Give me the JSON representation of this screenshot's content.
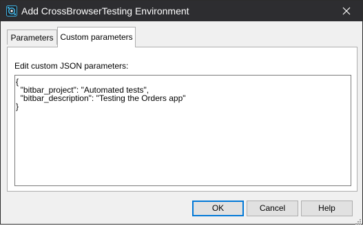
{
  "window": {
    "title": "Add CrossBrowserTesting Environment"
  },
  "tabs": [
    {
      "label": "Parameters"
    },
    {
      "label": "Custom parameters"
    }
  ],
  "panel": {
    "label": "Edit custom JSON parameters:",
    "editor_lines": [
      "{",
      "  \"bitbar_project\": \"Automated tests\",",
      "  \"bitbar_description\": \"Testing the Orders app\"",
      "}"
    ]
  },
  "buttons": {
    "ok": "OK",
    "cancel": "Cancel",
    "help": "Help"
  },
  "icons": {
    "title": "crossbrowsertesting-app-icon",
    "close": "close-icon"
  },
  "colors": {
    "titlebar": "#2d2d30",
    "focus_border": "#0078d7",
    "app_icon": "#3fb0e0"
  }
}
